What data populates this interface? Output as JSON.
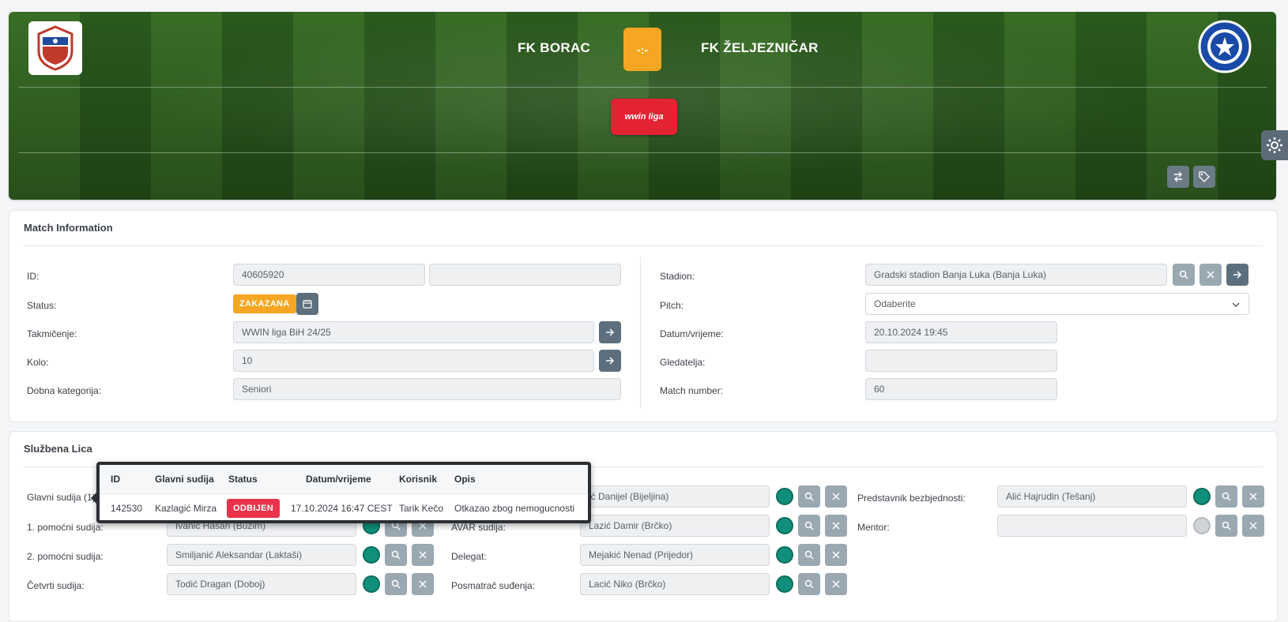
{
  "header": {
    "home_team": "FK BORAC",
    "away_team": "FK ŽELJEZNIČAR",
    "score": "-:-",
    "league_logo_text": "wwin liga",
    "score_color": "#f5a623",
    "league_color": "#e32332"
  },
  "match_info": {
    "title": "Match Information",
    "left": {
      "id_label": "ID:",
      "id_value": "40605920",
      "id_extra": "",
      "status_label": "Status:",
      "status_value": "ZAKAZANA",
      "competition_label": "Takmičenje:",
      "competition_value": "WWIN liga BiH 24/25",
      "round_label": "Kolo:",
      "round_value": "10",
      "age_label": "Dobna kategorija:",
      "age_value": "Seniori"
    },
    "right": {
      "stadium_label": "Stadion:",
      "stadium_value": "Gradski stadion Banja Luka (Banja Luka)",
      "pitch_label": "Pitch:",
      "pitch_value": "Odaberite",
      "datetime_label": "Datum/vrijeme:",
      "datetime_value": "20.10.2024 19:45",
      "spectators_label": "Gledatelja:",
      "spectators_value": "",
      "match_number_label": "Match number:",
      "match_number_value": "60"
    }
  },
  "officials": {
    "title": "Službena Lica",
    "col1": [
      {
        "label": "Glavni sudija (1):",
        "value": ""
      },
      {
        "label": "1. pomoćni sudija:",
        "value": "Ivanic Hasan (Bužim)"
      },
      {
        "label": "2. pomoćni sudija:",
        "value": "Smiljanić Aleksandar (Laktaši)"
      },
      {
        "label": "Četvrti sudija:",
        "value": "Todić Dragan (Doboj)"
      }
    ],
    "col2": [
      {
        "label": "",
        "value": "ić Danijel (Bijeljina)"
      },
      {
        "label": "AVAR sudija:",
        "value": "Lazić Damir (Brčko)"
      },
      {
        "label": "Delegat:",
        "value": "Mejakić Nenad (Prijedor)"
      },
      {
        "label": "Posmatrač suđenja:",
        "value": "Lacić Niko (Brčko)"
      }
    ],
    "col3": [
      {
        "label": "Predstavnik bezbjednosti:",
        "value": "Alić Hajrudin (Tešanj)"
      },
      {
        "label": "Mentor:",
        "value": ""
      }
    ]
  },
  "popover": {
    "headers": [
      "ID",
      "Glavni sudija",
      "Status",
      "Datum/vrijeme",
      "Korisnik",
      "Opis"
    ],
    "row": {
      "id": "142530",
      "referee": "Kazlagić Mirza",
      "status": "ODBIJEN",
      "datetime": "17.10.2024 16:47 CEST",
      "user": "Tarik Kečo",
      "description": "Otkazao zbog nemogucnosti"
    },
    "status_color": "#e8334a"
  }
}
